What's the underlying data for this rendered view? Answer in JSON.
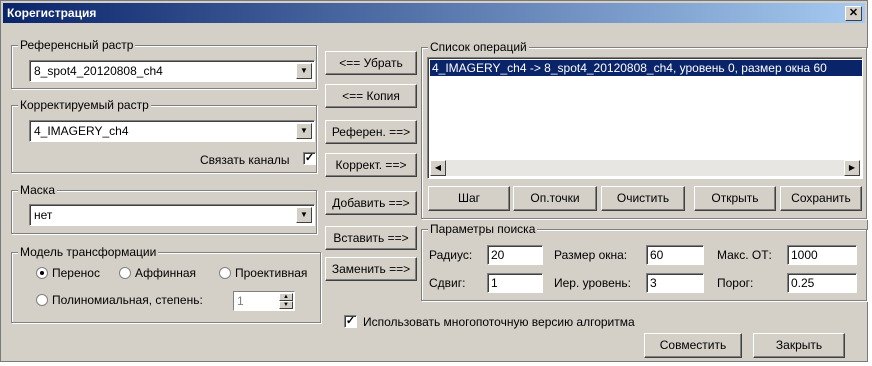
{
  "window": {
    "title": "Корегистрация"
  },
  "reference": {
    "label": "Референсный растр",
    "value": "8_spot4_20120808_ch4"
  },
  "corrected": {
    "label": "Корректируемый растр",
    "value": "4_IMAGERY_ch4",
    "link_channels_label": "Связать каналы",
    "link_channels_checked": true
  },
  "mask": {
    "label": "Маска",
    "value": "нет"
  },
  "transform": {
    "label": "Модель трансформации",
    "options": [
      "Перенос",
      "Аффинная",
      "Проективная"
    ],
    "selected": "Перенос",
    "poly_label": "Полиномиальная, степень:",
    "poly_degree": "1"
  },
  "mid_buttons": {
    "remove": "<== Убрать",
    "copy": "<== Копия",
    "refer": "Референ. ==>",
    "correct": "Коррект. ==>",
    "add": "Добавить ==>",
    "insert": "Вставить ==>",
    "replace": "Заменить ==>"
  },
  "operations": {
    "label": "Список операций",
    "items": [
      "4_IMAGERY_ch4 -> 8_spot4_20120808_ch4, уровень 0, размер окна 60"
    ],
    "buttons": {
      "step": "Шаг",
      "points": "Оп.точки",
      "clear": "Очистить",
      "open": "Открыть",
      "save": "Сохранить"
    }
  },
  "search": {
    "label": "Параметры поиска",
    "radius_label": "Радиус:",
    "radius": "20",
    "window_label": "Размер окна:",
    "window": "60",
    "max_label": "Макс. ОТ:",
    "max": "1000",
    "shift_label": "Сдвиг:",
    "shift": "1",
    "level_label": "Иер. уровень:",
    "level": "3",
    "threshold_label": "Порог:",
    "threshold": "0.25"
  },
  "multithread": {
    "label": "Использовать многопоточную версию алгоритма",
    "checked": true
  },
  "footer": {
    "apply": "Совместить",
    "close": "Закрыть"
  }
}
